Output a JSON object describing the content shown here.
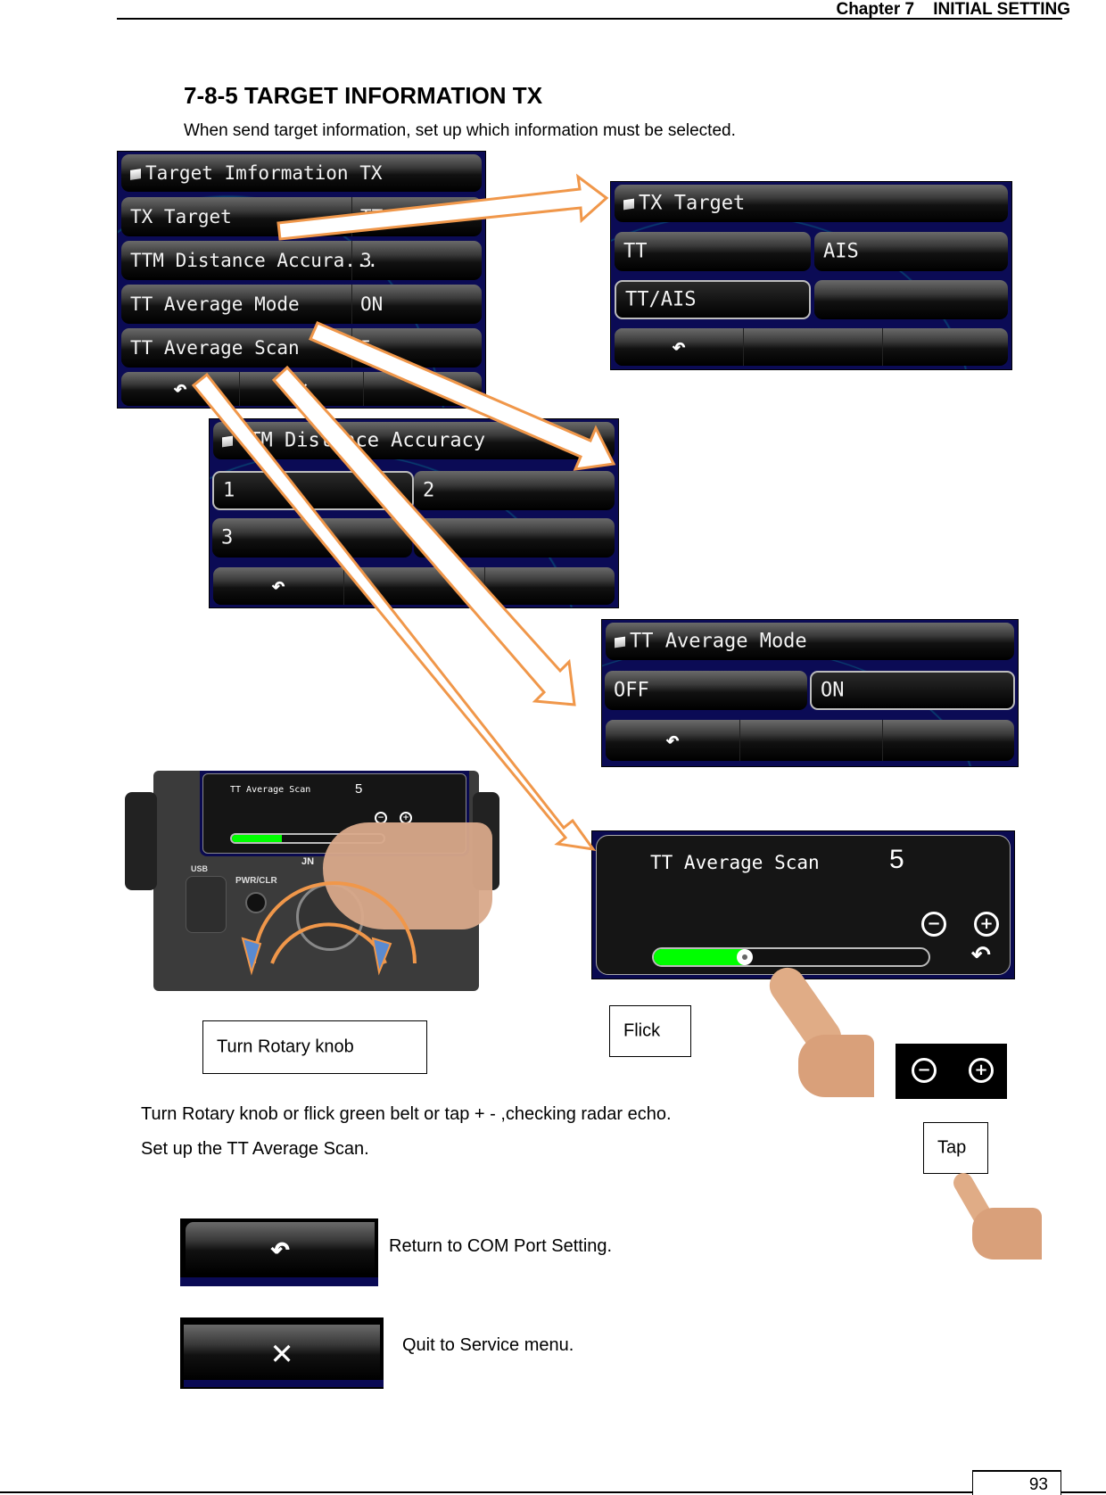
{
  "header": {
    "chapter": "Chapter 7    INITIAL SETTING"
  },
  "section": {
    "title": "7-8-5 TARGET INFORMATION TX",
    "intro": "When send target information, set up which information must be selected."
  },
  "menu_panel": {
    "title": "Target Imformation TX",
    "rows": [
      {
        "label": "TX Target",
        "value": "TT/AIS"
      },
      {
        "label": "TTM Distance Accura...",
        "value": "3"
      },
      {
        "label": "TT Average Mode",
        "value": "ON"
      },
      {
        "label": "TT Average Scan",
        "value": "5"
      }
    ],
    "footer_icons": [
      "back-icon",
      "close-icon"
    ]
  },
  "tx_target_panel": {
    "title": "TX Target",
    "options": [
      "TT",
      "AIS",
      "TT/AIS",
      ""
    ],
    "selected": "TT/AIS"
  },
  "ttm_panel": {
    "title": "TTM Distance Accuracy",
    "options": [
      "1",
      "2",
      "3",
      ""
    ],
    "selected": "1"
  },
  "avg_mode_panel": {
    "title": "TT Average Mode",
    "options": [
      "OFF",
      "ON"
    ],
    "selected": "ON"
  },
  "avg_scan_panel": {
    "title": "TT Average Scan",
    "value": "5",
    "slider_fraction": 0.33,
    "minus": "−",
    "plus": "+"
  },
  "device_screen": {
    "title": "TT Average Scan",
    "value": "5",
    "slider_fraction": 0.33,
    "usb_label": "USB",
    "pwr_label": "PWR/CLR",
    "brand_partial": "JN"
  },
  "callouts": {
    "turn_knob": "Turn Rotary knob",
    "flick": "Flick",
    "tap": "Tap"
  },
  "instructions": [
    "Turn Rotary knob or flick green belt or tap + - ,checking radar echo.",
    "Set up the TT Average Scan."
  ],
  "legend": [
    {
      "icon": "back-icon",
      "text": "Return to COM Port Setting."
    },
    {
      "icon": "close-icon",
      "text": "Quit to Service menu."
    }
  ],
  "page_number": "93",
  "colors": {
    "arrow": "#f0974a",
    "slider": "#00ff00",
    "panel_bg": "#0b0b55"
  }
}
